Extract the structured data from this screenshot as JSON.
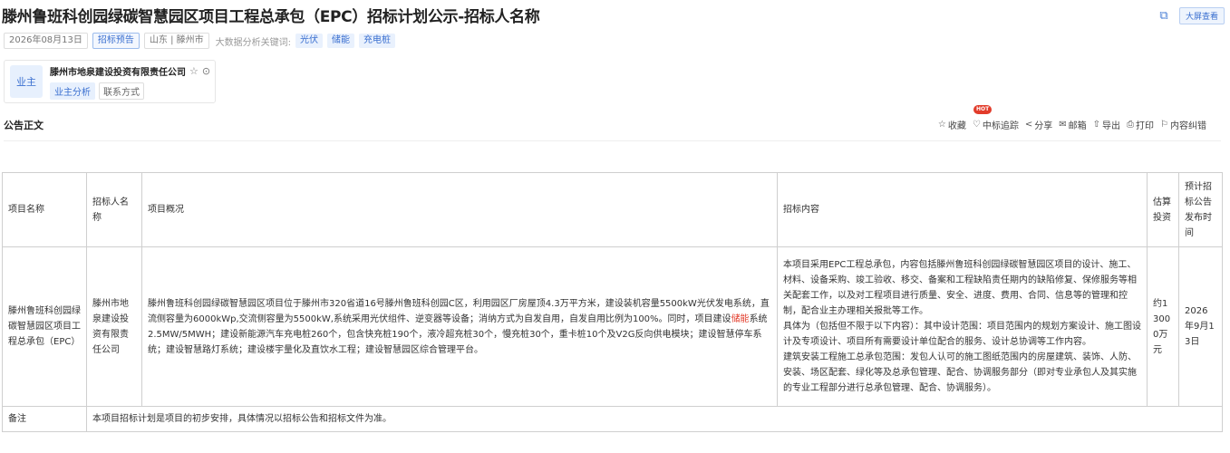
{
  "header": {
    "title": "滕州鲁班科创园绿碳智慧园区项目工程总承包（EPC）招标计划公示-招标人名称",
    "copy_icon": "copy-icon",
    "big_screen_label": "大屏查看"
  },
  "meta": {
    "date": "2026年08月13日",
    "type": "招标预告",
    "region": "山东 | 滕州市",
    "keywords_label": "大数据分析关键词:",
    "keywords": [
      "光伏",
      "储能",
      "充电桩"
    ]
  },
  "owner": {
    "badge": "业主",
    "name": "滕州市地泉建设投资有限责任公司",
    "analysis_label": "业主分析",
    "contact_label": "联系方式"
  },
  "section": {
    "title": "公告正文",
    "hot": "HOT"
  },
  "toolbar": {
    "items": [
      {
        "label": "收藏",
        "icon": "☆"
      },
      {
        "label": "中标追踪",
        "icon": "♡"
      },
      {
        "label": "分享",
        "icon": "<"
      },
      {
        "label": "邮箱",
        "icon": "✉"
      },
      {
        "label": "导出",
        "icon": "⇧"
      },
      {
        "label": "打印",
        "icon": "⎙"
      },
      {
        "label": "内容纠错",
        "icon": "⚐"
      }
    ]
  },
  "table": {
    "headers": [
      "项目名称",
      "招标人名称",
      "项目概况",
      "招标内容",
      "估算投资",
      "预计招标公告发布时间"
    ],
    "row": {
      "name": "滕州鲁班科创园绿碳智慧园区项目工程总承包（EPC）",
      "tenderer": "滕州市地泉建设投资有限责任公司",
      "overview_before": "滕州鲁班科创园绿碳智慧园区项目位于滕州市320省道16号滕州鲁班科创园C区，利用园区厂房屋顶4.3万平方米，建设装机容量5500kW光伏发电系统，直流侧容量为6000kWp,交流侧容量为5500kW,系统采用光伏组件、逆变器等设备；消纳方式为自发自用，自发自用比例为100%。同时，项目建设",
      "overview_highlight": "储能",
      "overview_after": "系统2.5MW/5MWH；建设新能源汽车充电桩260个，包含快充桩190个，液冷超充桩30个，慢充桩30个，重卡桩10个及V2G反向供电模块；建设智慧停车系统；建设智慧路灯系统；建设楼宇量化及直饮水工程；建设智慧园区综合管理平台。",
      "content_p1": "本项目采用EPC工程总承包，内容包括滕州鲁班科创园绿碳智慧园区项目的设计、施工、材料、设备采购、竣工验收、移交、备案和工程缺陷责任期内的缺陷修复、保修服务等相关配套工作，以及对工程项目进行质量、安全、进度、费用、合同、信息等的管理和控制，配合业主办理相关报批等工作。",
      "content_p2": "具体为（包括但不限于以下内容）：其中设计范围：项目范围内的规划方案设计、施工图设计及专项设计、项目所有需要设计单位配合的服务、设计总协调等工作内容。",
      "content_p3": "建筑安装工程施工总承包范围：发包人认可的施工图纸范围内的房屋建筑、装饰、人防、安装、场区配套、绿化等及总承包管理、配合、协调服务部分（即对专业承包人及其实施的专业工程部分进行总承包管理、配合、协调服务）。",
      "investment": "约13000万元",
      "publish_time": "2026年9月13日"
    },
    "note_label": "备注",
    "note_text": "本项目招标计划是项目的初步安排，具体情况以招标公告和招标文件为准。"
  }
}
